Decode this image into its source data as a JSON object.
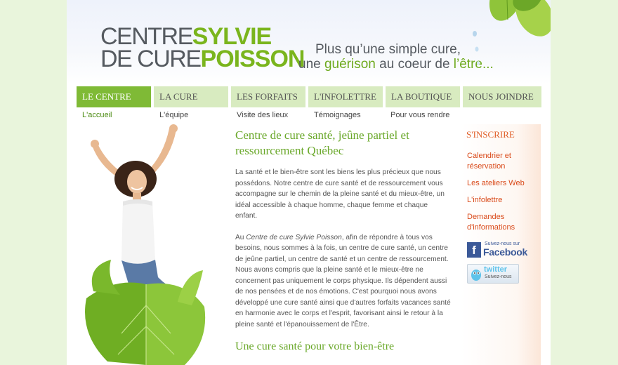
{
  "logo": {
    "line1_grey": "CENTRE",
    "line1_green": "SYLVIE",
    "line2_grey": "DE CURE",
    "line2_green": "POISSON"
  },
  "tagline": {
    "line1": "Plus qu’une simple cure,",
    "line2_pre": "une ",
    "line2_green1": "guérison",
    "line2_mid": " au coeur de ",
    "line2_green2": "l’être..."
  },
  "nav": {
    "tabs": [
      {
        "label": "LE CENTRE",
        "sub": "L'accueil"
      },
      {
        "label": "LA CURE",
        "sub": "L'équipe"
      },
      {
        "label": "LES FORFAITS",
        "sub": "Visite des lieux"
      },
      {
        "label": "L'INFOLETTRE",
        "sub": "Témoignages"
      },
      {
        "label": "LA BOUTIQUE",
        "sub": "Pour vous rendre"
      },
      {
        "label": "NOUS JOINDRE",
        "sub": ""
      }
    ]
  },
  "content": {
    "heading": "Centre de cure santé, jeûne partiel et ressourcement Québec",
    "para1": "La santé et le bien-être sont les biens les plus précieux que nous possédons. Notre centre de cure santé et de ressourcement vous accompagne sur le chemin de la pleine santé et du mieux-être, un idéal accessible à chaque homme, chaque femme et chaque enfant.",
    "para2_pre": "Au ",
    "para2_em": "Centre de cure Sylvie Poisson",
    "para2_post": ", afin de répondre à tous vos besoins, nous sommes à la fois, un centre de cure santé, un centre de jeûne partiel, un centre de santé et un centre de ressourcement. Nous avons compris que la pleine santé et le mieux-être ne concernent pas uniquement le corps physique. Ils dépendent aussi de nos pensées et de nos émotions. C'est pourquoi nous avons développé une cure santé ainsi que d'autres forfaits vacances santé en harmonie avec le corps et l'esprit, favorisant ainsi le retour à la pleine santé et l'épanouissement de l'Être.",
    "subheading": "Une cure santé pour votre bien-être"
  },
  "sidebar": {
    "heading": "S'INSCRIRE",
    "links": [
      "Calendrier et réservation",
      "Les ateliers Web",
      "L'infolettre",
      "Demandes d'informations"
    ],
    "facebook_small": "Suivez-nous sur",
    "facebook_big": "Facebook",
    "twitter_big": "twitter",
    "twitter_small": "Suivez-nous"
  },
  "colors": {
    "accent_green": "#7fba36",
    "tab_bg": "#d8ebc0",
    "link_orange": "#d94a1a",
    "page_bg": "#e9f5dc"
  }
}
